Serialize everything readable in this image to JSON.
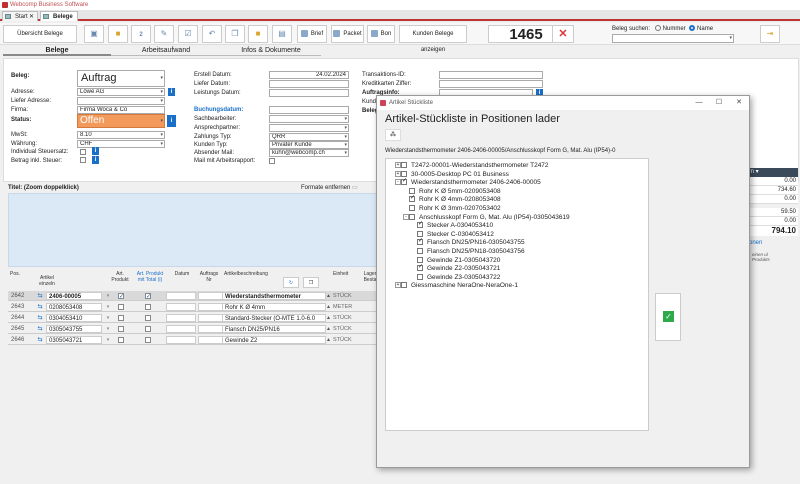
{
  "app": {
    "title": "Webcomp Business Software"
  },
  "doc_tabs": [
    {
      "label": "Start"
    },
    {
      "label": "Belege"
    }
  ],
  "toolbar": {
    "overview": "Übersicht Belege",
    "brief": "Brief",
    "packet": "Packet",
    "bon": "Bon",
    "kunden_belege": "Kunden Belege anzeigen",
    "doc_number": "1465",
    "search_label": "Beleg suchen:",
    "opt_number": "Nummer",
    "opt_name": "Name",
    "badge": "2"
  },
  "subtabs": [
    {
      "label": "Belege"
    },
    {
      "label": "Arbeitsaufwand"
    },
    {
      "label": "Infos & Dokumente"
    }
  ],
  "form": {
    "beleg_label": "Beleg:",
    "beleg_value": "Auftrag",
    "adresse_label": "Adresse:",
    "adresse_value": "Löwe AG",
    "liefer_label": "Liefer Adresse:",
    "firma_label": "Firma:",
    "firma_value": "Firma Woca & Co",
    "status_label": "Status:",
    "status_value": "Offen",
    "mwst_label": "MwSt:",
    "mwst_value": "8.10",
    "waehrung_label": "Währung:",
    "waehrung_value": "CHF",
    "indiv_label": "Individual Steuersatz:",
    "betrag_label": "Betrag inkl. Steuer:",
    "erstell_label": "Erstell Datum:",
    "erstell_value": "24.02.2024",
    "lieferdatum_label": "Liefer Datum:",
    "leistung_label": "Leistungs Datum:",
    "buchung_label": "Buchungsdatum:",
    "sachbearbeiter_label": "Sachbearbeiter:",
    "ansprech_label": "Ansprechpartner:",
    "zahlung_label": "Zahlungs Typ:",
    "zahlung_value": "QRR",
    "kunden_typ_label": "Kunden Typ:",
    "kunden_typ_value": "Privater Kunde",
    "absender_label": "Absender Mail:",
    "absender_value": "kuhn@webcomp.ch",
    "mail_label": "Mail mit Arbeitsrapport:",
    "trans_label": "Transaktions-ID:",
    "kredit_label": "Kreditkarten Ziffer:",
    "auftragsinfo_label": "Auftragsinfo:",
    "kund_label": "Kund",
    "beleg2_label": "Beleg"
  },
  "desc": {
    "title": "Titel: (Zoom doppelklick)",
    "formats": "Formate entfernen"
  },
  "grid": {
    "headers": {
      "pos": "Pos.",
      "artikel": "Artikel einzeln",
      "artprod": "Art. Produkt",
      "artprodtot": "Art. Produkt mit Total (i)",
      "datum": "Datum",
      "auftrags": "Auftrags Nr",
      "beschr": "Artikelbeschreibung",
      "einheit": "Einheit",
      "lager": "Lager Besta"
    },
    "rows": [
      {
        "pos": "2642",
        "nr": "2406-00005",
        "desc": "Wiederstandsthermometer",
        "unit": "STÜCK",
        "c1": true,
        "c2": true
      },
      {
        "pos": "2643",
        "nr": "0208053408",
        "desc": "Rohr K Ø 4mm",
        "unit": "METER",
        "c1": false,
        "c2": false
      },
      {
        "pos": "2644",
        "nr": "0304053410",
        "desc": "Standard-Stecker (O-MTE 1.0-6.0",
        "unit": "STÜCK",
        "c1": false,
        "c2": false
      },
      {
        "pos": "2645",
        "nr": "0305043755",
        "desc": "Flansch DN25/PN16",
        "unit": "STÜCK",
        "c1": false,
        "c2": false
      },
      {
        "pos": "2646",
        "nr": "0305043721",
        "desc": "Gewinde Z2",
        "unit": "STÜCK",
        "c1": false,
        "c2": false
      }
    ]
  },
  "right_panel": {
    "header": "issern",
    "values": [
      "0.00",
      "734.60",
      "0.00",
      "59.50",
      "0.00"
    ],
    "total": "794.10",
    "link": "tionen",
    "footnote": "einen ul Produkts"
  },
  "dialog": {
    "window_title": "Artikel Stückliste",
    "heading": "Artikel-Stückliste in Positionen lader",
    "path": "Wiederstandsthermometer 2406-2406-00005/Anschlusskopf Form G, Mat. Alu (IP54)-0",
    "tree": [
      {
        "label": "T2472-00001-Wiederstandsthermometer T2472",
        "checked": false,
        "exp": "+",
        "level": 0
      },
      {
        "label": "30-0005-Desktop PC 01 Business",
        "checked": false,
        "exp": "+",
        "level": 0
      },
      {
        "label": "Wiederstandsthermometer 2406-2406-00005",
        "checked": true,
        "exp": "-",
        "level": 0
      },
      {
        "label": "Rohr K Ø 5mm-0209053408",
        "checked": false,
        "exp": "",
        "level": 1
      },
      {
        "label": "Rohr K Ø 4mm-0208053408",
        "checked": true,
        "exp": "",
        "level": 1
      },
      {
        "label": "Rohr K Ø 3mm-0207053402",
        "checked": false,
        "exp": "",
        "level": 1
      },
      {
        "label": "Anschlusskopf Form G, Mat. Alu (IP54)-0305043619",
        "checked": false,
        "exp": "-",
        "level": 1
      },
      {
        "label": "Stecker A-0304053410",
        "checked": true,
        "exp": "",
        "level": 2
      },
      {
        "label": "Stecker C-0304053412",
        "checked": false,
        "exp": "",
        "level": 2
      },
      {
        "label": "Flansch DN25/PN16-0305043755",
        "checked": true,
        "exp": "",
        "level": 2
      },
      {
        "label": "Flansch DN25/PN18-0305043756",
        "checked": false,
        "exp": "",
        "level": 2
      },
      {
        "label": "Gewinde Z1-0305043720",
        "checked": false,
        "exp": "",
        "level": 2
      },
      {
        "label": "Gewinde Z2-0305043721",
        "checked": true,
        "exp": "",
        "level": 2
      },
      {
        "label": "Gewinde Z3-0305043722",
        "checked": false,
        "exp": "",
        "level": 2
      },
      {
        "label": "Giessmaschine NeraOne-NeraOne-1",
        "checked": false,
        "exp": "+",
        "level": 0
      }
    ]
  },
  "colors": {
    "accent": "#1a6fc9",
    "status_orange": "#f29a5c",
    "brand_red": "#b33333",
    "ok_green": "#2faa4a"
  }
}
